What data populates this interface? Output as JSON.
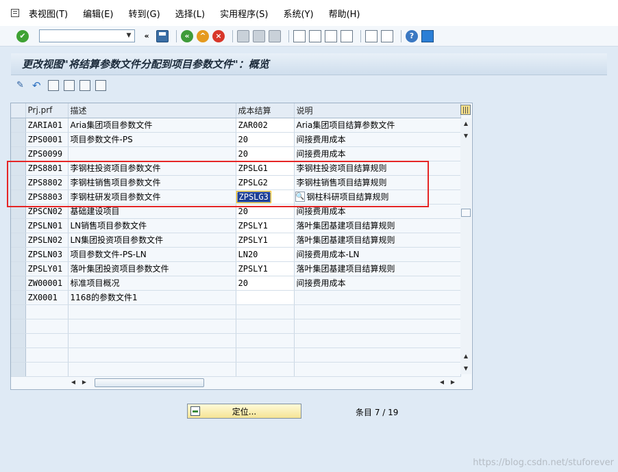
{
  "menu": {
    "items": [
      "表视图(T)",
      "编辑(E)",
      "转到(G)",
      "选择(L)",
      "实用程序(S)",
      "系统(Y)",
      "帮助(H)"
    ]
  },
  "toolbar": {
    "command_value": "",
    "back_label": "«"
  },
  "title": "更改视图\"将结算参数文件分配到项目参数文件\"：概览",
  "table": {
    "headers": [
      "Prj.prf",
      "描述",
      "成本结算",
      "说明"
    ],
    "rows": [
      {
        "prf": "ZARIA01",
        "desc": "Aria集团项目参数文件",
        "cost": "ZAR002",
        "note": "Aria集团项目结算参数文件"
      },
      {
        "prf": "ZPS0001",
        "desc": "项目参数文件-PS",
        "cost": "20",
        "note": "间接费用成本"
      },
      {
        "prf": "ZPS0099",
        "desc": "",
        "cost": "20",
        "note": "间接费用成本"
      },
      {
        "prf": "ZPS8801",
        "desc": "李钢柱投资项目参数文件",
        "cost": "ZPSLG1",
        "note": "李钢柱投资项目结算规则"
      },
      {
        "prf": "ZPS8802",
        "desc": "李钢柱销售项目参数文件",
        "cost": "ZPSLG2",
        "note": "李钢柱销售项目结算规则"
      },
      {
        "prf": "ZPS8803",
        "desc": "李钢柱研发项目参数文件",
        "cost": "ZPSLG3",
        "note": "钢柱科研项目结算规则"
      },
      {
        "prf": "ZPSCN02",
        "desc": "基础建设项目",
        "cost": "20",
        "note": "间接费用成本"
      },
      {
        "prf": "ZPSLN01",
        "desc": "LN销售项目参数文件",
        "cost": "ZPSLY1",
        "note": "落叶集团基建项目结算规则"
      },
      {
        "prf": "ZPSLN02",
        "desc": "LN集团投资项目参数文件",
        "cost": "ZPSLY1",
        "note": "落叶集团基建项目结算规则"
      },
      {
        "prf": "ZPSLN03",
        "desc": "项目参数文件-PS-LN",
        "cost": "LN20",
        "note": "间接费用成本-LN"
      },
      {
        "prf": "ZPSLY01",
        "desc": "落叶集团投资项目参数文件",
        "cost": "ZPSLY1",
        "note": "落叶集团基建项目结算规则"
      },
      {
        "prf": "ZW00001",
        "desc": "标准项目概况",
        "cost": "20",
        "note": "间接费用成本"
      },
      {
        "prf": "ZX0001",
        "desc": "1168的参数文件1",
        "cost": "",
        "note": ""
      }
    ]
  },
  "footer": {
    "position_label": "定位...",
    "entries_label": "条目 7 / 19"
  },
  "watermark": "https://blog.csdn.net/stuforever"
}
